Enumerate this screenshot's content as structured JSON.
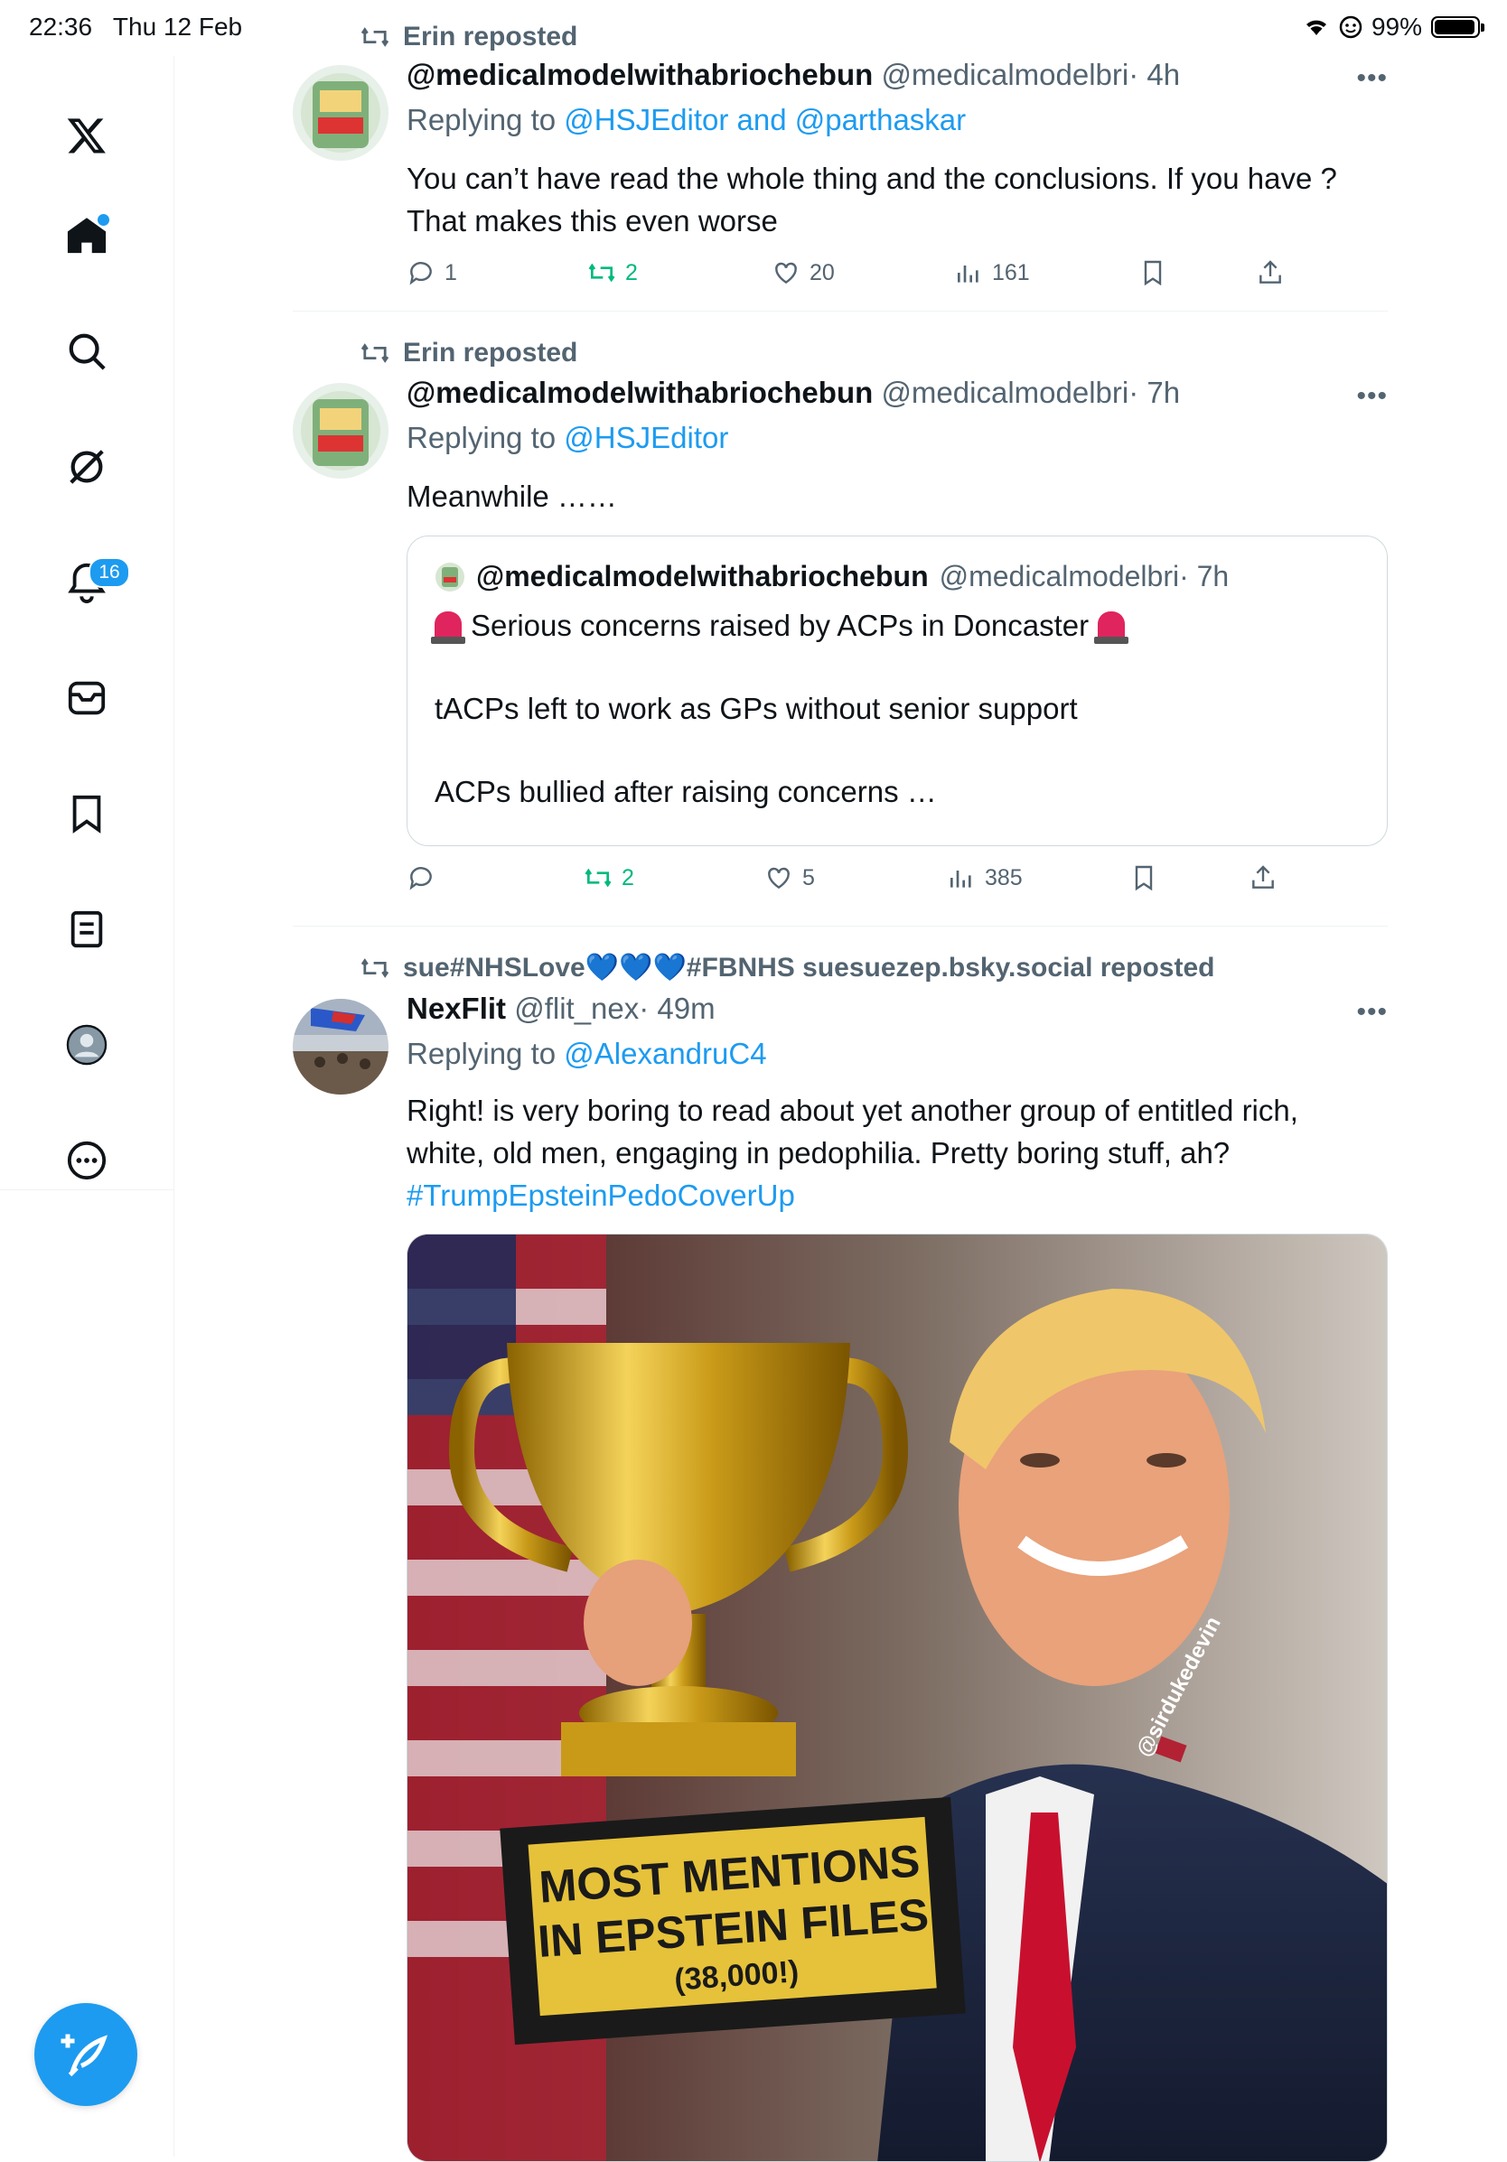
{
  "status_bar": {
    "time": "22:36",
    "date": "Thu 12 Feb",
    "battery": "99%"
  },
  "sidebar": {
    "notifications_count": "16"
  },
  "posts": [
    {
      "repost_by": "Erin reposted",
      "name": "@medicalmodelwithabriochebun",
      "handle": "@medicalmodelbri",
      "time": "· 4h",
      "replying_prefix": "Replying to",
      "replying_to": "@HSJEditor and @parthaskar",
      "text_1": "You can’t have read the whole thing and the conclusions. If you have ?",
      "text_2": "That makes this even worse",
      "stats": {
        "replies": "1",
        "reposts": "2",
        "likes": "20",
        "views": "161"
      }
    },
    {
      "repost_by": "Erin reposted",
      "name": "@medicalmodelwithabriochebun",
      "handle": "@medicalmodelbri",
      "time": "· 7h",
      "replying_prefix": "Replying to",
      "replying_to": "@HSJEditor",
      "text_1": "Meanwhile ……",
      "quote": {
        "name": "@medicalmodelwithabriochebun",
        "handle": "@medicalmodelbri",
        "time": "· 7h",
        "line_1": "Serious concerns raised by ACPs in Doncaster",
        "line_2": "tACPs left to work as GPs without senior support",
        "line_3": "ACPs bullied after raising concerns …"
      },
      "stats": {
        "replies": "",
        "reposts": "2",
        "likes": "5",
        "views": "385"
      }
    },
    {
      "repost_by": "sue#NHSLove💙💙💙#FBNHS suesuezep.bsky.social reposted",
      "name": "NexFlit",
      "handle": "@flit_nex",
      "time": "· 49m",
      "replying_prefix": "Replying to",
      "replying_to": "@AlexandruC4",
      "text_1": "Right! is very boring to read about yet another group of entitled rich,",
      "text_2": "white, old men, engaging in pedophilia. Pretty boring stuff, ah?",
      "hashtag": "#TrumpEpsteinPedoCoverUp",
      "image": {
        "plaque_line_1": "MOST MENTIONS",
        "plaque_line_2": "IN EPSTEIN FILES",
        "plaque_line_3": "(38,000!)",
        "watermark": "@sirdukedevin"
      }
    }
  ]
}
